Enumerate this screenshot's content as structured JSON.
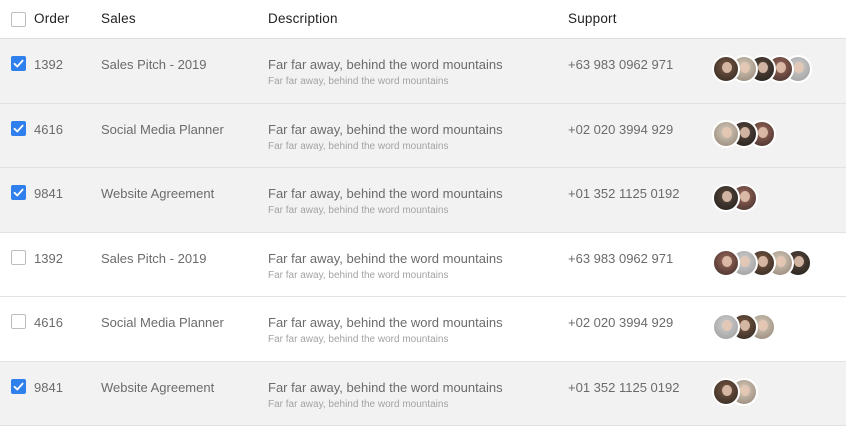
{
  "header": {
    "order": "Order",
    "sales": "Sales",
    "description": "Description",
    "support": "Support"
  },
  "rows": [
    {
      "checked": true,
      "order": "1392",
      "sales": "Sales Pitch - 2019",
      "desc_main": "Far far away, behind the word mountains",
      "desc_sub": "Far far away, behind the word mountains",
      "support": "+63 983 0962 971",
      "avatar_count": 5
    },
    {
      "checked": true,
      "order": "4616",
      "sales": "Social Media Planner",
      "desc_main": "Far far away, behind the word mountains",
      "desc_sub": "Far far away, behind the word mountains",
      "support": "+02 020 3994 929",
      "avatar_count": 3
    },
    {
      "checked": true,
      "order": "9841",
      "sales": "Website Agreement",
      "desc_main": "Far far away, behind the word mountains",
      "desc_sub": "Far far away, behind the word mountains",
      "support": "+01 352 1125 0192",
      "avatar_count": 2
    },
    {
      "checked": false,
      "order": "1392",
      "sales": "Sales Pitch - 2019",
      "desc_main": "Far far away, behind the word mountains",
      "desc_sub": "Far far away, behind the word mountains",
      "support": "+63 983 0962 971",
      "avatar_count": 5
    },
    {
      "checked": false,
      "order": "4616",
      "sales": "Social Media Planner",
      "desc_main": "Far far away, behind the word mountains",
      "desc_sub": "Far far away, behind the word mountains",
      "support": "+02 020 3994 929",
      "avatar_count": 3
    },
    {
      "checked": true,
      "order": "9841",
      "sales": "Website Agreement",
      "desc_main": "Far far away, behind the word mountains",
      "desc_sub": "Far far away, behind the word mountains",
      "support": "+01 352 1125 0192",
      "avatar_count": 2
    }
  ],
  "colors": {
    "checkbox_checked": "#2f80ed",
    "row_shaded": "#f2f2f2",
    "row_plain": "#ffffff"
  }
}
